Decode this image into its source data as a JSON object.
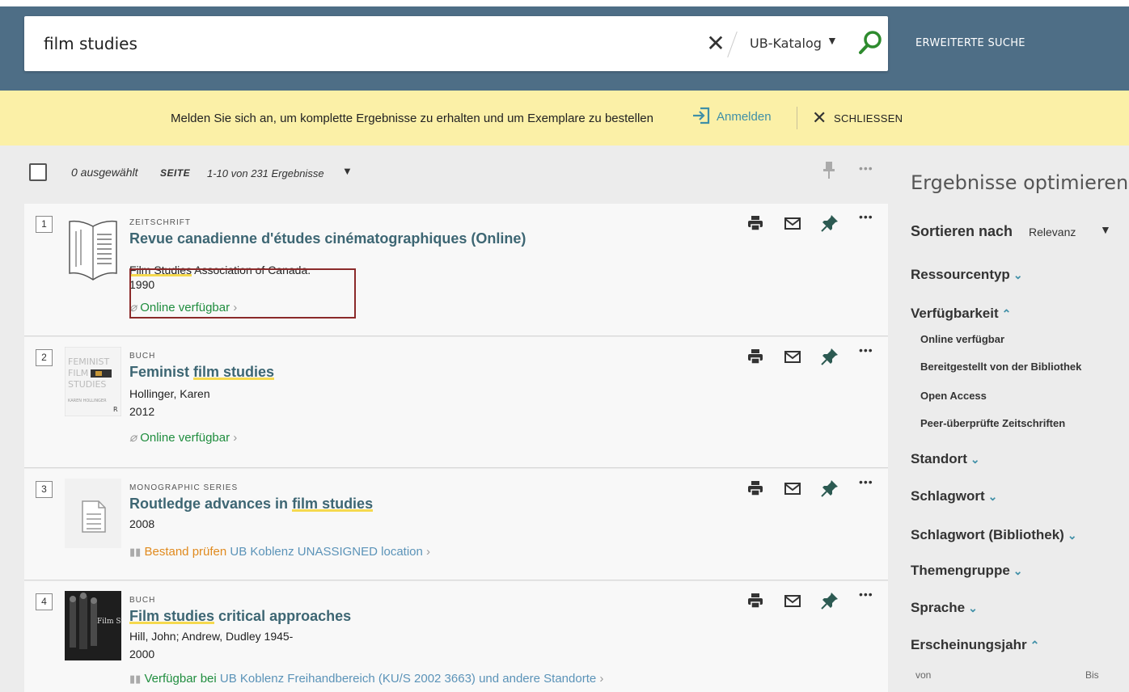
{
  "search": {
    "value": "film studies",
    "scope": "UB-Katalog",
    "advanced_label": "ERWEITERTE SUCHE"
  },
  "banner": {
    "text": "Melden Sie sich an, um komplette Ergebnisse zu erhalten und um Exemplare zu bestellen",
    "signin_label": "Anmelden",
    "close_label": "SCHLIESSEN"
  },
  "toolbar": {
    "selected": "0 ausgewählt",
    "page_label": "SEITE",
    "page_range": "1-10 von 231 Ergebnisse"
  },
  "results": [
    {
      "num": "1",
      "type": "ZEITSCHRIFT",
      "title": "Revue canadienne d'études cinématographiques (Online)",
      "author_hl": "Film Studies",
      "author_rest": " Association of Canada.",
      "year": "1990",
      "avail": "Online verfügbar"
    },
    {
      "num": "2",
      "type": "BUCH",
      "title_pre": "Feminist ",
      "title_hl": "film studies",
      "author": "Hollinger, Karen",
      "year": "2012",
      "avail": "Online verfügbar",
      "cover_title": "FEMINIST FILM STUDIES",
      "cover_author": "KAREN HOLLINGER"
    },
    {
      "num": "3",
      "type": "MONOGRAPHIC SERIES",
      "title_pre": "Routledge advances in ",
      "title_hl": "film studies",
      "year": "2008",
      "avail_status": "Bestand prüfen",
      "avail_lib": "UB Koblenz",
      "avail_loc": "UNASSIGNED location"
    },
    {
      "num": "4",
      "type": "BUCH",
      "title_hl": "Film studies",
      "title_post": " critical approaches",
      "author": "Hill, John; Andrew, Dudley 1945-",
      "year": "2000",
      "avail_status": "Verfügbar bei",
      "avail_lib": "UB Koblenz",
      "avail_loc": "Freihandbereich (KU/S 2002 3663) und andere Standorte",
      "cover_title": "Film Studies"
    }
  ],
  "sidebar": {
    "title": "Ergebnisse optimieren",
    "sort_label": "Sortieren nach",
    "sort_value": "Relevanz",
    "facets": {
      "ressourcentyp": "Ressourcentyp",
      "verfuegbarkeit": "Verfügbarkeit",
      "standort": "Standort",
      "schlagwort": "Schlagwort",
      "schlagwort_bib": "Schlagwort (Bibliothek)",
      "themengruppe": "Themengruppe",
      "sprache": "Sprache",
      "erscheinungsjahr": "Erscheinungsjahr"
    },
    "avail_items": [
      "Online verfügbar",
      "Bereitgestellt von der Bibliothek",
      "Open Access",
      "Peer-überprüfte Zeitschriften"
    ],
    "year_from_label": "von",
    "year_to_label": "Bis"
  },
  "colors": {
    "header": "#4e6e86",
    "banner": "#fbf0a7",
    "title": "#3d6673",
    "available": "#1f8d3e",
    "check": "#e08a1e",
    "link": "#3f8fa7",
    "search_icon": "#2e8b2e"
  }
}
